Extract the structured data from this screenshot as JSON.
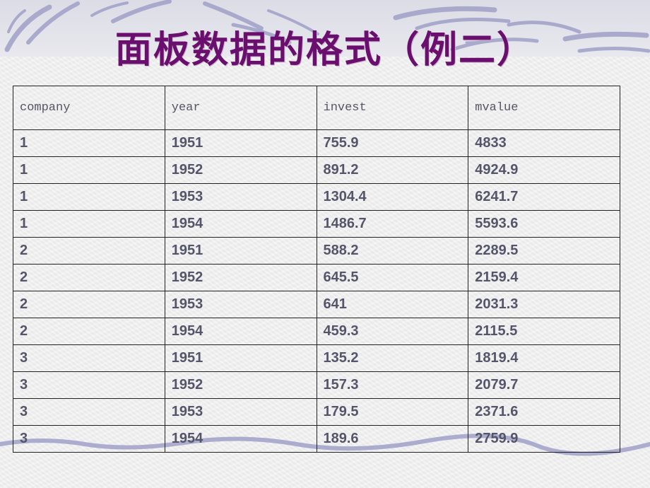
{
  "slide": {
    "title": "面板数据的格式（例二）"
  },
  "table": {
    "headers": [
      "company",
      "year",
      "invest",
      "mvalue"
    ],
    "rows": [
      [
        "1",
        "1951",
        "755.9",
        "4833"
      ],
      [
        "1",
        "1952",
        "891.2",
        "4924.9"
      ],
      [
        "1",
        "1953",
        "1304.4",
        "6241.7"
      ],
      [
        "1",
        "1954",
        "1486.7",
        "5593.6"
      ],
      [
        "2",
        "1951",
        "588.2",
        "2289.5"
      ],
      [
        "2",
        "1952",
        "645.5",
        "2159.4"
      ],
      [
        "2",
        "1953",
        "641",
        "2031.3"
      ],
      [
        "2",
        "1954",
        "459.3",
        "2115.5"
      ],
      [
        "3",
        "1951",
        "135.2",
        "1819.4"
      ],
      [
        "3",
        "1952",
        "157.3",
        "2079.7"
      ],
      [
        "3",
        "1953",
        "179.5",
        "2371.6"
      ],
      [
        "3",
        "1954",
        "189.6",
        "2759.9"
      ]
    ]
  },
  "theme": {
    "title_color": "#6b0f6e",
    "text_color": "#55556a",
    "stroke_color": "#9a9ac4"
  }
}
